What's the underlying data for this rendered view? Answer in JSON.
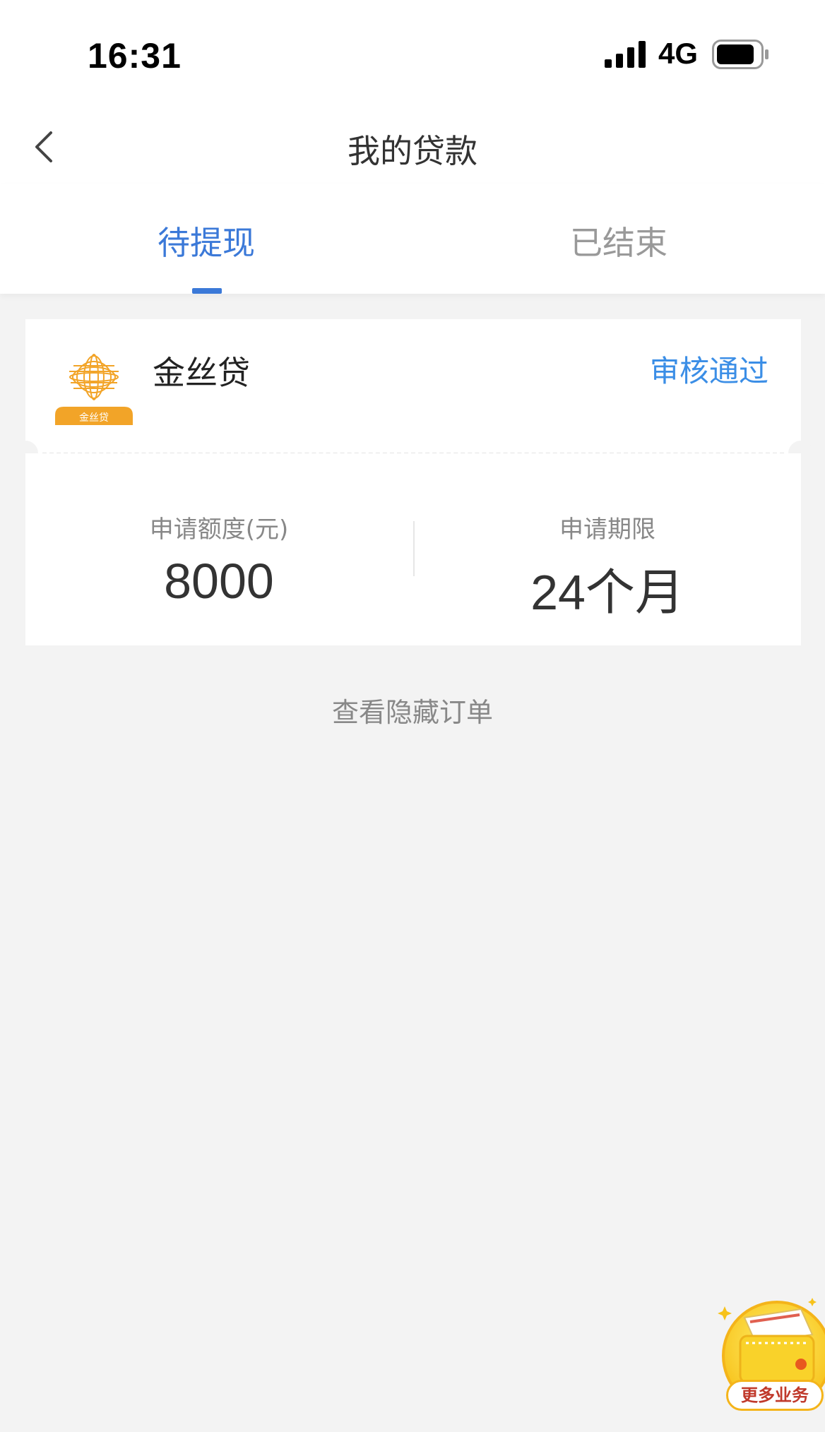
{
  "status_bar": {
    "time": "16:31",
    "network": "4G"
  },
  "navbar": {
    "title": "我的贷款"
  },
  "tabs": [
    {
      "label": "待提现",
      "active": true
    },
    {
      "label": "已结束",
      "active": false
    }
  ],
  "loan_card": {
    "logo_text": "金丝贷",
    "product_name": "金丝贷",
    "status": "审核通过",
    "amount_label": "申请额度(元)",
    "amount_value": "8000",
    "term_label": "申请期限",
    "term_value": "24个月"
  },
  "hidden_orders_link": "查看隐藏订单",
  "floating_button": {
    "label": "更多业务"
  },
  "colors": {
    "accent": "#3b79d8",
    "status": "#3b8ee6",
    "logo": "#f2a428",
    "background": "#f3f3f3"
  }
}
